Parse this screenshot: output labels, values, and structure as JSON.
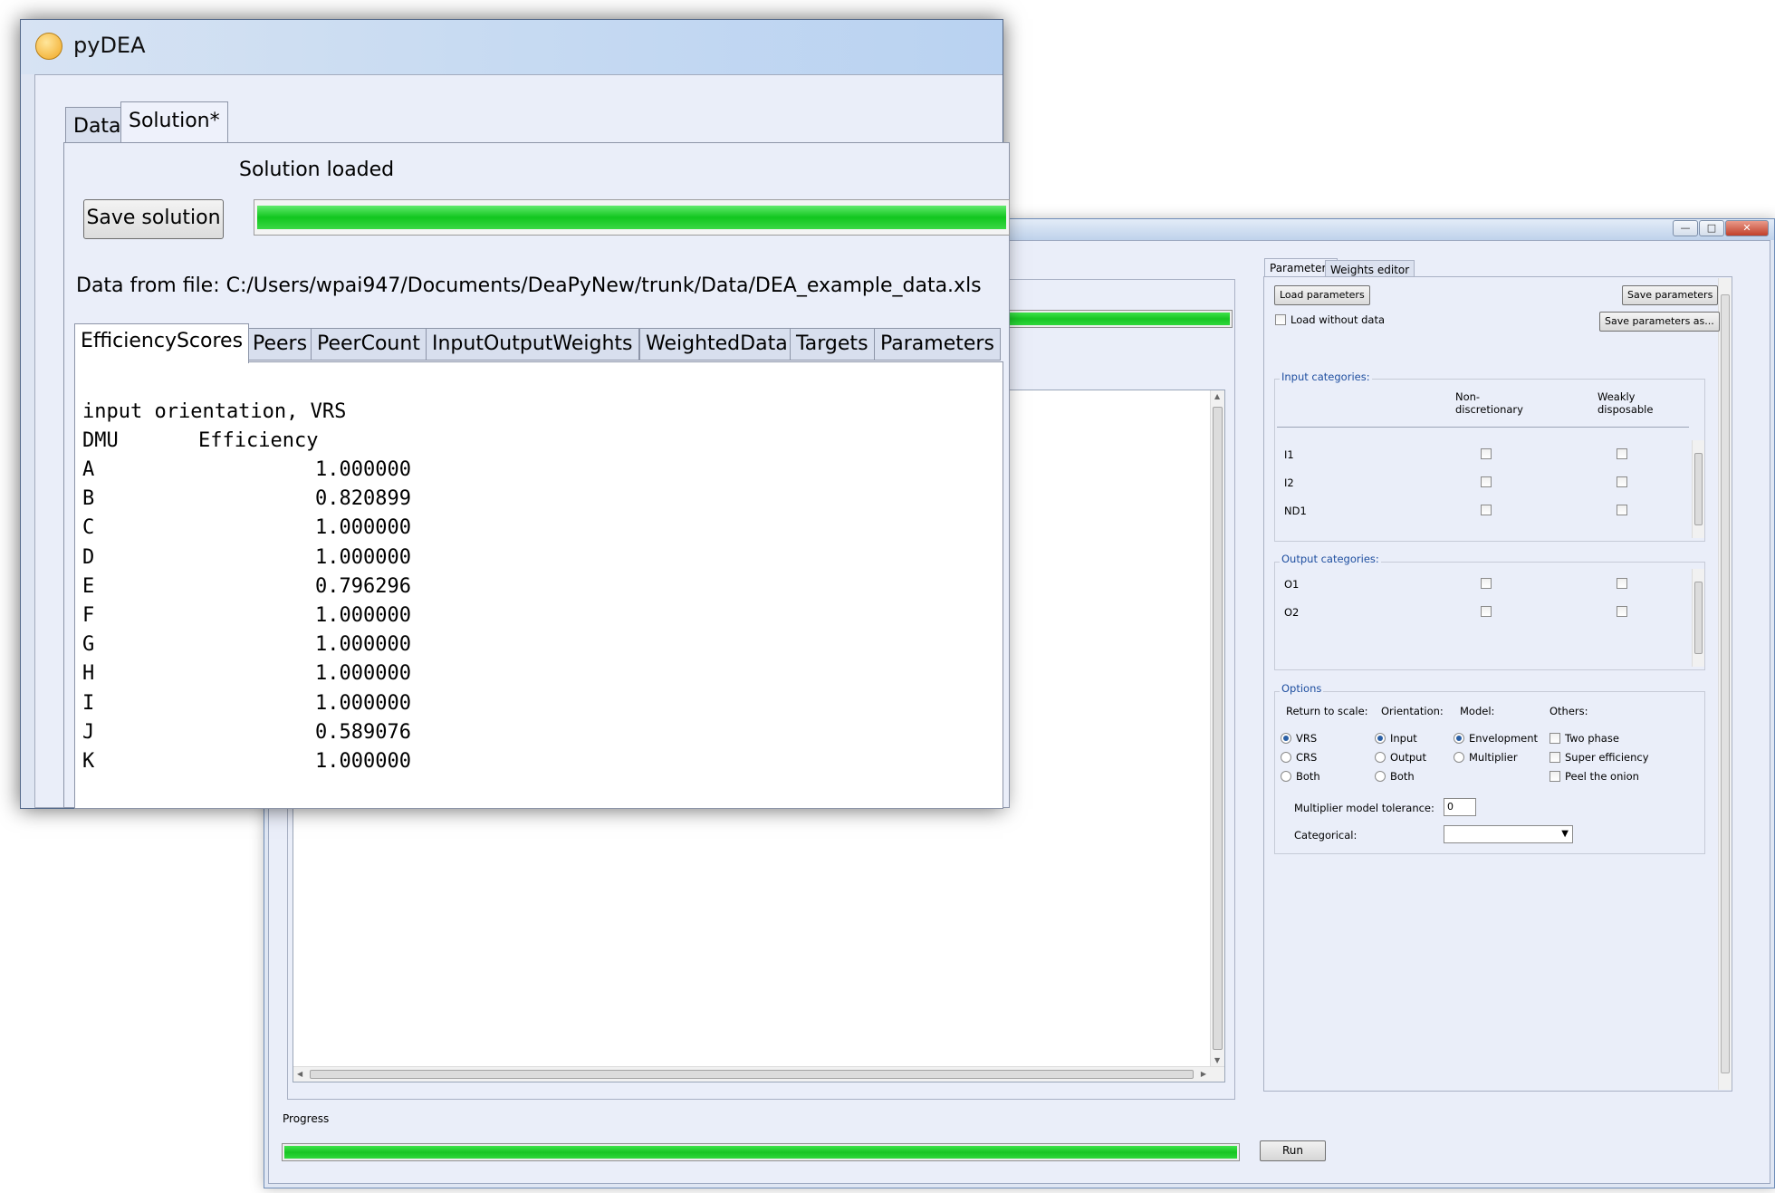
{
  "front_window": {
    "title": "pyDEA",
    "tabs": [
      "Data",
      "Solution*"
    ],
    "status": "Solution loaded",
    "save_button": "Save solution",
    "progress": 1.0,
    "data_file": "Data from file: C:/Users/wpai947/Documents/DeaPyNew/trunk/Data/DEA_example_data.xls",
    "result_tabs": [
      "EfficiencyScores",
      "Peers",
      "PeerCount",
      "InputOutputWeights",
      "WeightedData",
      "Targets",
      "Parameters"
    ],
    "result_header": "input orientation, VRS",
    "table_header": {
      "dmu": "DMU",
      "eff": "Efficiency"
    },
    "rows": [
      {
        "dmu": "A",
        "eff": "1.000000"
      },
      {
        "dmu": "B",
        "eff": "0.820899"
      },
      {
        "dmu": "C",
        "eff": "1.000000"
      },
      {
        "dmu": "D",
        "eff": "1.000000"
      },
      {
        "dmu": "E",
        "eff": "0.796296"
      },
      {
        "dmu": "F",
        "eff": "1.000000"
      },
      {
        "dmu": "G",
        "eff": "1.000000"
      },
      {
        "dmu": "H",
        "eff": "1.000000"
      },
      {
        "dmu": "I",
        "eff": "1.000000"
      },
      {
        "dmu": "J",
        "eff": "0.589076"
      },
      {
        "dmu": "K",
        "eff": "1.000000"
      }
    ]
  },
  "back_window": {
    "window_controls": {
      "minimize": "—",
      "maximize": "□",
      "close": "✕"
    },
    "param_tabs": [
      "Parameters",
      "Weights editor"
    ],
    "load_parameters": "Load parameters",
    "save_parameters": "Save parameters",
    "save_parameters_as": "Save parameters as...",
    "load_without_data": "Load without data",
    "input_categories": "Input categories:",
    "col_non_discretionary": "Non-\ndiscretionary",
    "col_weakly_disposable": "Weakly\ndisposable",
    "inputs": [
      "I1",
      "I2",
      "ND1"
    ],
    "output_categories": "Output categories:",
    "outputs": [
      "O1",
      "O2"
    ],
    "options_title": "Options",
    "return_to_scale": {
      "label": "Return to scale:",
      "options": [
        "VRS",
        "CRS",
        "Both"
      ],
      "selected": "VRS"
    },
    "orientation": {
      "label": "Orientation:",
      "options": [
        "Input",
        "Output",
        "Both"
      ],
      "selected": "Input"
    },
    "model": {
      "label": "Model:",
      "options": [
        "Envelopment",
        "Multiplier"
      ],
      "selected": "Envelopment"
    },
    "others": {
      "label": "Others:",
      "options": [
        "Two phase",
        "Super efficiency",
        "Peel the onion"
      ]
    },
    "multiplier_tolerance_label": "Multiplier model tolerance:",
    "multiplier_tolerance_value": "0",
    "categorical_label": "Categorical:",
    "progress_label": "Progress",
    "progress": 1.0,
    "run_button": "Run"
  }
}
